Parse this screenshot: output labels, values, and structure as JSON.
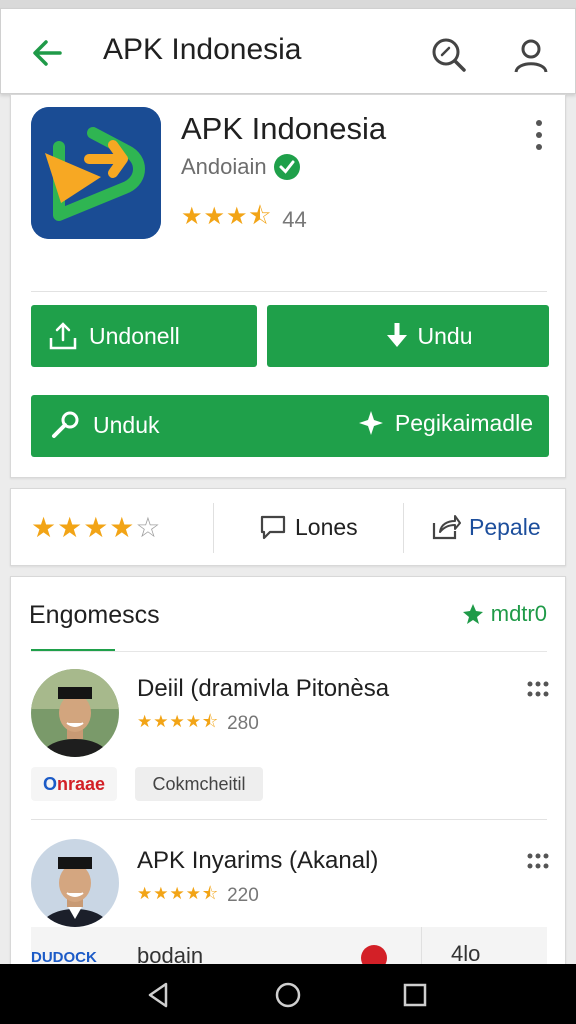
{
  "appbar": {
    "title": "APK Indonesia",
    "back_icon": "arrow-back-icon",
    "search_icon": "search-icon",
    "account_icon": "account-icon"
  },
  "app": {
    "name": "APK Indonesia",
    "developer": "Andoiain",
    "rating_value": 3.5,
    "rating_text": "44",
    "icon": "app-logo-icon"
  },
  "actions": {
    "primary_left": "Undonell",
    "primary_right": "Undu",
    "secondary_left": "Unduk",
    "secondary_right": "Pegikaimadle"
  },
  "summary": {
    "stars_value": 4,
    "lones_label": "Lones",
    "share_label": "Pepale"
  },
  "section": {
    "title": "Engomescs",
    "link": "mdtr0"
  },
  "items": [
    {
      "title": "Deiil (dramivla Pitonèsa",
      "rating_text": "280",
      "brand": "nraae",
      "brand_lead": "O",
      "tag": "Cokmcheitil"
    },
    {
      "title": "APK Inyarims (Akanal)",
      "rating_text": "220"
    }
  ],
  "partial": {
    "brand": "DUDOCK",
    "tag": "bodain",
    "extra": "4lo"
  },
  "colors": {
    "accent_green": "#1fa04a",
    "star": "#f2a416",
    "app_icon_bg": "#1a4c94"
  }
}
